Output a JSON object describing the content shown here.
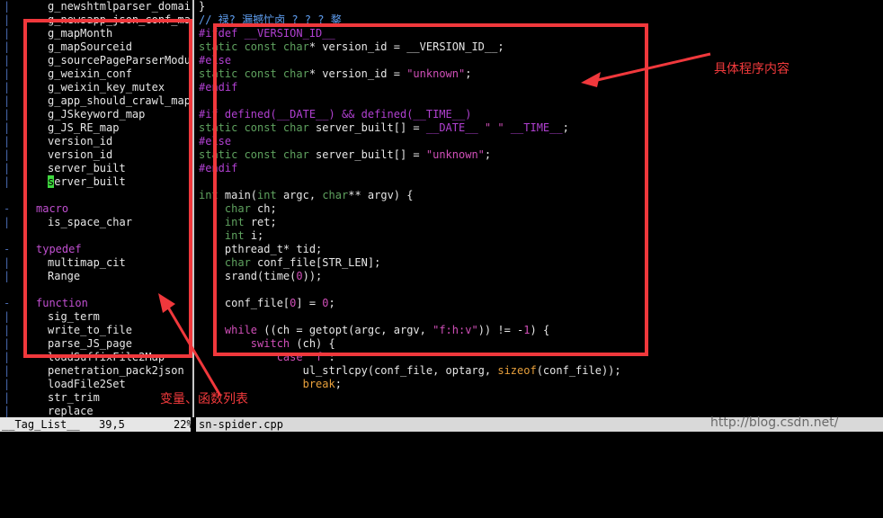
{
  "taglist": {
    "rows": [
      {
        "kind": "tag",
        "text": "g_newshtmlparser_domain",
        "bar": "|"
      },
      {
        "kind": "tag",
        "text": "g_newsapp_json_conf_map",
        "bar": "|"
      },
      {
        "kind": "tag",
        "text": "g_mapMonth",
        "bar": "|"
      },
      {
        "kind": "tag",
        "text": "g_mapSourceid",
        "bar": "|"
      },
      {
        "kind": "tag",
        "text": "g_sourcePageParserModu",
        "bar": "|"
      },
      {
        "kind": "tag",
        "text": "g_weixin_conf",
        "bar": "|"
      },
      {
        "kind": "tag",
        "text": "g_weixin_key_mutex",
        "bar": "|"
      },
      {
        "kind": "tag",
        "text": "g_app_should_crawl_map",
        "bar": "|"
      },
      {
        "kind": "tag",
        "text": "g_JSkeyword_map",
        "bar": "|"
      },
      {
        "kind": "tag",
        "text": "g_JS_RE_map",
        "bar": "|"
      },
      {
        "kind": "tag",
        "text": "version_id",
        "bar": "|"
      },
      {
        "kind": "tag",
        "text": "version_id",
        "bar": "|"
      },
      {
        "kind": "tag",
        "text": "server_built",
        "bar": "|"
      },
      {
        "kind": "cursor",
        "cursor_char": "s",
        "text": "erver_built",
        "bar": "|"
      },
      {
        "kind": "blank",
        "text": "",
        "bar": ""
      },
      {
        "kind": "kind",
        "text": "macro",
        "bar": "-"
      },
      {
        "kind": "tag",
        "text": "is_space_char",
        "bar": "|"
      },
      {
        "kind": "blank",
        "text": "",
        "bar": ""
      },
      {
        "kind": "kind",
        "text": "typedef",
        "bar": "-"
      },
      {
        "kind": "tag",
        "text": "multimap_cit",
        "bar": "|"
      },
      {
        "kind": "tag",
        "text": "Range",
        "bar": "|"
      },
      {
        "kind": "blank",
        "text": "",
        "bar": ""
      },
      {
        "kind": "kind",
        "text": "function",
        "bar": "-"
      },
      {
        "kind": "tag",
        "text": "sig_term",
        "bar": "|"
      },
      {
        "kind": "tag",
        "text": "write_to_file",
        "bar": "|"
      },
      {
        "kind": "tag",
        "text": "parse_JS_page",
        "bar": "|"
      },
      {
        "kind": "tag",
        "text": "loadSuffixFile2Map",
        "bar": "|"
      },
      {
        "kind": "tag",
        "text": "penetration_pack2json",
        "bar": "|"
      },
      {
        "kind": "tag",
        "text": "loadFile2Set",
        "bar": "|"
      },
      {
        "kind": "tag",
        "text": "str_trim",
        "bar": "|"
      },
      {
        "kind": "tag",
        "text": "replace",
        "bar": "|"
      }
    ]
  },
  "code": {
    "lines": [
      [
        {
          "c": "plain",
          "t": "}"
        }
      ],
      [
        {
          "c": "cmt",
          "t": "// 禄? 漏撼忙卤 ? ? ? 鍪"
        }
      ],
      [
        {
          "c": "pp",
          "t": "#ifdef __VERSION_ID__"
        }
      ],
      [
        {
          "c": "ty",
          "t": "static const char"
        },
        {
          "c": "plain",
          "t": "* version_id = __VERSION_ID__;"
        }
      ],
      [
        {
          "c": "pp",
          "t": "#else"
        }
      ],
      [
        {
          "c": "ty",
          "t": "static const char"
        },
        {
          "c": "plain",
          "t": "* version_id = "
        },
        {
          "c": "str",
          "t": "\"unknown\""
        },
        {
          "c": "plain",
          "t": ";"
        }
      ],
      [
        {
          "c": "pp",
          "t": "#endif"
        }
      ],
      [
        {
          "c": "plain",
          "t": ""
        }
      ],
      [
        {
          "c": "pp",
          "t": "#if defined(__DATE__) && defined(__TIME__)"
        }
      ],
      [
        {
          "c": "ty",
          "t": "static const char"
        },
        {
          "c": "plain",
          "t": " server_built[] = "
        },
        {
          "c": "pp",
          "t": "__DATE__"
        },
        {
          "c": "str",
          "t": " \" \" "
        },
        {
          "c": "pp",
          "t": "__TIME__"
        },
        {
          "c": "plain",
          "t": ";"
        }
      ],
      [
        {
          "c": "pp",
          "t": "#else"
        }
      ],
      [
        {
          "c": "ty",
          "t": "static const char"
        },
        {
          "c": "plain",
          "t": " server_built[] = "
        },
        {
          "c": "str",
          "t": "\"unknown\""
        },
        {
          "c": "plain",
          "t": ";"
        }
      ],
      [
        {
          "c": "pp",
          "t": "#endif"
        }
      ],
      [
        {
          "c": "plain",
          "t": ""
        }
      ],
      [
        {
          "c": "ty",
          "t": "int"
        },
        {
          "c": "plain",
          "t": " main("
        },
        {
          "c": "ty",
          "t": "int"
        },
        {
          "c": "plain",
          "t": " argc, "
        },
        {
          "c": "ty",
          "t": "char"
        },
        {
          "c": "plain",
          "t": "** argv) {"
        }
      ],
      [
        {
          "c": "plain",
          "t": "    "
        },
        {
          "c": "ty",
          "t": "char"
        },
        {
          "c": "plain",
          "t": " ch;"
        }
      ],
      [
        {
          "c": "plain",
          "t": "    "
        },
        {
          "c": "ty",
          "t": "int"
        },
        {
          "c": "plain",
          "t": " ret;"
        }
      ],
      [
        {
          "c": "plain",
          "t": "    "
        },
        {
          "c": "ty",
          "t": "int"
        },
        {
          "c": "plain",
          "t": " i;"
        }
      ],
      [
        {
          "c": "plain",
          "t": "    pthread_t* tid;"
        }
      ],
      [
        {
          "c": "plain",
          "t": "    "
        },
        {
          "c": "ty",
          "t": "char"
        },
        {
          "c": "plain",
          "t": " conf_file[STR_LEN];"
        }
      ],
      [
        {
          "c": "plain",
          "t": "    srand(time("
        },
        {
          "c": "num",
          "t": "0"
        },
        {
          "c": "plain",
          "t": "));"
        }
      ],
      [
        {
          "c": "plain",
          "t": ""
        }
      ],
      [
        {
          "c": "plain",
          "t": "    conf_file["
        },
        {
          "c": "num",
          "t": "0"
        },
        {
          "c": "plain",
          "t": "] = "
        },
        {
          "c": "num",
          "t": "0"
        },
        {
          "c": "plain",
          "t": ";"
        }
      ],
      [
        {
          "c": "plain",
          "t": ""
        }
      ],
      [
        {
          "c": "plain",
          "t": "    "
        },
        {
          "c": "kw",
          "t": "while"
        },
        {
          "c": "plain",
          "t": " ((ch = getopt(argc, argv, "
        },
        {
          "c": "str",
          "t": "\"f:h:v\""
        },
        {
          "c": "plain",
          "t": ")) != -"
        },
        {
          "c": "num",
          "t": "1"
        },
        {
          "c": "plain",
          "t": ") {"
        }
      ],
      [
        {
          "c": "plain",
          "t": "        "
        },
        {
          "c": "kw",
          "t": "switch"
        },
        {
          "c": "plain",
          "t": " (ch) {"
        }
      ],
      [
        {
          "c": "plain",
          "t": "            "
        },
        {
          "c": "kw",
          "t": "case"
        },
        {
          "c": "plain",
          "t": " "
        },
        {
          "c": "str",
          "t": "'f'"
        },
        {
          "c": "plain",
          "t": ":"
        }
      ],
      [
        {
          "c": "plain",
          "t": "                ul_strlcpy(conf_file, optarg, "
        },
        {
          "c": "fn",
          "t": "sizeof"
        },
        {
          "c": "plain",
          "t": "(conf_file));"
        }
      ],
      [
        {
          "c": "plain",
          "t": "                "
        },
        {
          "c": "fn",
          "t": "break"
        },
        {
          "c": "plain",
          "t": ";"
        }
      ]
    ]
  },
  "status": {
    "left_name": "__Tag_List__",
    "left_pos": "39,5",
    "right_pct": "22%",
    "right_file": "sn-spider.cpp"
  },
  "annotations": {
    "code_label": "具体程序内容",
    "taglist_label": "变量、函数列表",
    "watermark": "http://blog.csdn.net/"
  },
  "colors": {
    "highlight_box": "#f0383c",
    "cursor": "#3fd83f"
  }
}
